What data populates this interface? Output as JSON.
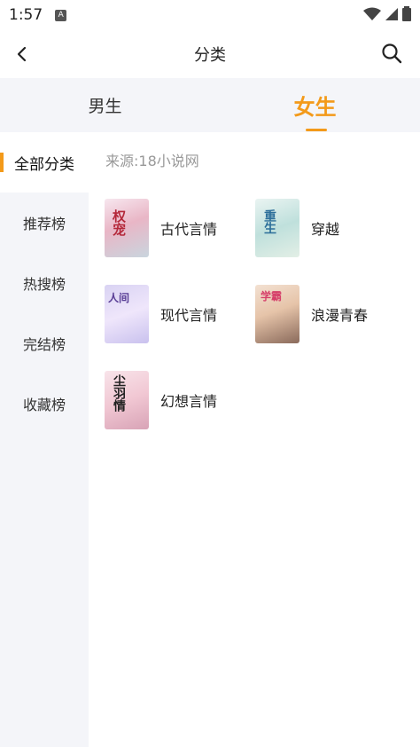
{
  "status": {
    "time": "1:57"
  },
  "header": {
    "title": "分类"
  },
  "gender_tabs": [
    {
      "label": "男生",
      "active": false
    },
    {
      "label": "女生",
      "active": true
    }
  ],
  "sidebar": {
    "items": [
      {
        "label": "全部分类",
        "active": true
      },
      {
        "label": "推荐榜",
        "active": false
      },
      {
        "label": "热搜榜",
        "active": false
      },
      {
        "label": "完结榜",
        "active": false
      },
      {
        "label": "收藏榜",
        "active": false
      }
    ]
  },
  "main": {
    "source": "来源:18小说网",
    "categories": [
      {
        "label": "古代言情",
        "cover_text": "权宠"
      },
      {
        "label": "穿越",
        "cover_text": "重生"
      },
      {
        "label": "现代言情",
        "cover_text": "人间"
      },
      {
        "label": "浪漫青春",
        "cover_text": "学霸"
      },
      {
        "label": "幻想言情",
        "cover_text": "尘羽情"
      }
    ]
  },
  "colors": {
    "accent": "#f39a1a",
    "sidebar_bg": "#f4f5f9"
  }
}
